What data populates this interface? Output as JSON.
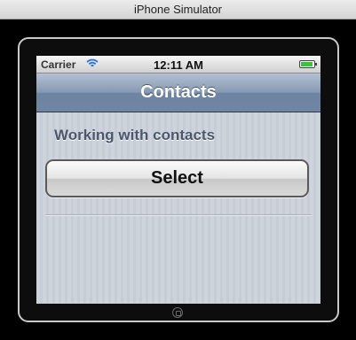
{
  "window": {
    "title": "iPhone Simulator"
  },
  "status_bar": {
    "carrier": "Carrier",
    "time": "12:11 AM",
    "battery_level": 0.9,
    "wifi_icon": "wifi-icon"
  },
  "nav_bar": {
    "title": "Contacts"
  },
  "content": {
    "heading": "Working with contacts",
    "select_button_label": "Select"
  },
  "colors": {
    "nav_bar": "#7489a6",
    "heading_text": "#4c566c",
    "battery_fill": "#3cc13c"
  }
}
